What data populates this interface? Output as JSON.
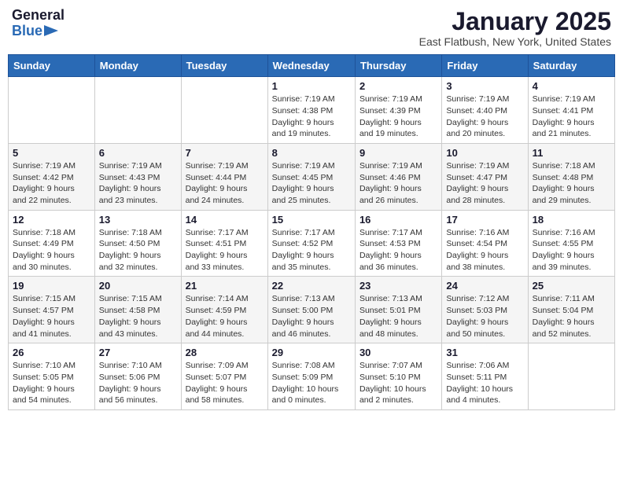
{
  "header": {
    "logo_line1": "General",
    "logo_line2": "Blue",
    "title": "January 2025",
    "subtitle": "East Flatbush, New York, United States"
  },
  "calendar": {
    "days_of_week": [
      "Sunday",
      "Monday",
      "Tuesday",
      "Wednesday",
      "Thursday",
      "Friday",
      "Saturday"
    ],
    "weeks": [
      [
        {
          "day": "",
          "info": ""
        },
        {
          "day": "",
          "info": ""
        },
        {
          "day": "",
          "info": ""
        },
        {
          "day": "1",
          "info": "Sunrise: 7:19 AM\nSunset: 4:38 PM\nDaylight: 9 hours\nand 19 minutes."
        },
        {
          "day": "2",
          "info": "Sunrise: 7:19 AM\nSunset: 4:39 PM\nDaylight: 9 hours\nand 19 minutes."
        },
        {
          "day": "3",
          "info": "Sunrise: 7:19 AM\nSunset: 4:40 PM\nDaylight: 9 hours\nand 20 minutes."
        },
        {
          "day": "4",
          "info": "Sunrise: 7:19 AM\nSunset: 4:41 PM\nDaylight: 9 hours\nand 21 minutes."
        }
      ],
      [
        {
          "day": "5",
          "info": "Sunrise: 7:19 AM\nSunset: 4:42 PM\nDaylight: 9 hours\nand 22 minutes."
        },
        {
          "day": "6",
          "info": "Sunrise: 7:19 AM\nSunset: 4:43 PM\nDaylight: 9 hours\nand 23 minutes."
        },
        {
          "day": "7",
          "info": "Sunrise: 7:19 AM\nSunset: 4:44 PM\nDaylight: 9 hours\nand 24 minutes."
        },
        {
          "day": "8",
          "info": "Sunrise: 7:19 AM\nSunset: 4:45 PM\nDaylight: 9 hours\nand 25 minutes."
        },
        {
          "day": "9",
          "info": "Sunrise: 7:19 AM\nSunset: 4:46 PM\nDaylight: 9 hours\nand 26 minutes."
        },
        {
          "day": "10",
          "info": "Sunrise: 7:19 AM\nSunset: 4:47 PM\nDaylight: 9 hours\nand 28 minutes."
        },
        {
          "day": "11",
          "info": "Sunrise: 7:18 AM\nSunset: 4:48 PM\nDaylight: 9 hours\nand 29 minutes."
        }
      ],
      [
        {
          "day": "12",
          "info": "Sunrise: 7:18 AM\nSunset: 4:49 PM\nDaylight: 9 hours\nand 30 minutes."
        },
        {
          "day": "13",
          "info": "Sunrise: 7:18 AM\nSunset: 4:50 PM\nDaylight: 9 hours\nand 32 minutes."
        },
        {
          "day": "14",
          "info": "Sunrise: 7:17 AM\nSunset: 4:51 PM\nDaylight: 9 hours\nand 33 minutes."
        },
        {
          "day": "15",
          "info": "Sunrise: 7:17 AM\nSunset: 4:52 PM\nDaylight: 9 hours\nand 35 minutes."
        },
        {
          "day": "16",
          "info": "Sunrise: 7:17 AM\nSunset: 4:53 PM\nDaylight: 9 hours\nand 36 minutes."
        },
        {
          "day": "17",
          "info": "Sunrise: 7:16 AM\nSunset: 4:54 PM\nDaylight: 9 hours\nand 38 minutes."
        },
        {
          "day": "18",
          "info": "Sunrise: 7:16 AM\nSunset: 4:55 PM\nDaylight: 9 hours\nand 39 minutes."
        }
      ],
      [
        {
          "day": "19",
          "info": "Sunrise: 7:15 AM\nSunset: 4:57 PM\nDaylight: 9 hours\nand 41 minutes."
        },
        {
          "day": "20",
          "info": "Sunrise: 7:15 AM\nSunset: 4:58 PM\nDaylight: 9 hours\nand 43 minutes."
        },
        {
          "day": "21",
          "info": "Sunrise: 7:14 AM\nSunset: 4:59 PM\nDaylight: 9 hours\nand 44 minutes."
        },
        {
          "day": "22",
          "info": "Sunrise: 7:13 AM\nSunset: 5:00 PM\nDaylight: 9 hours\nand 46 minutes."
        },
        {
          "day": "23",
          "info": "Sunrise: 7:13 AM\nSunset: 5:01 PM\nDaylight: 9 hours\nand 48 minutes."
        },
        {
          "day": "24",
          "info": "Sunrise: 7:12 AM\nSunset: 5:03 PM\nDaylight: 9 hours\nand 50 minutes."
        },
        {
          "day": "25",
          "info": "Sunrise: 7:11 AM\nSunset: 5:04 PM\nDaylight: 9 hours\nand 52 minutes."
        }
      ],
      [
        {
          "day": "26",
          "info": "Sunrise: 7:10 AM\nSunset: 5:05 PM\nDaylight: 9 hours\nand 54 minutes."
        },
        {
          "day": "27",
          "info": "Sunrise: 7:10 AM\nSunset: 5:06 PM\nDaylight: 9 hours\nand 56 minutes."
        },
        {
          "day": "28",
          "info": "Sunrise: 7:09 AM\nSunset: 5:07 PM\nDaylight: 9 hours\nand 58 minutes."
        },
        {
          "day": "29",
          "info": "Sunrise: 7:08 AM\nSunset: 5:09 PM\nDaylight: 10 hours\nand 0 minutes."
        },
        {
          "day": "30",
          "info": "Sunrise: 7:07 AM\nSunset: 5:10 PM\nDaylight: 10 hours\nand 2 minutes."
        },
        {
          "day": "31",
          "info": "Sunrise: 7:06 AM\nSunset: 5:11 PM\nDaylight: 10 hours\nand 4 minutes."
        },
        {
          "day": "",
          "info": ""
        }
      ]
    ]
  }
}
